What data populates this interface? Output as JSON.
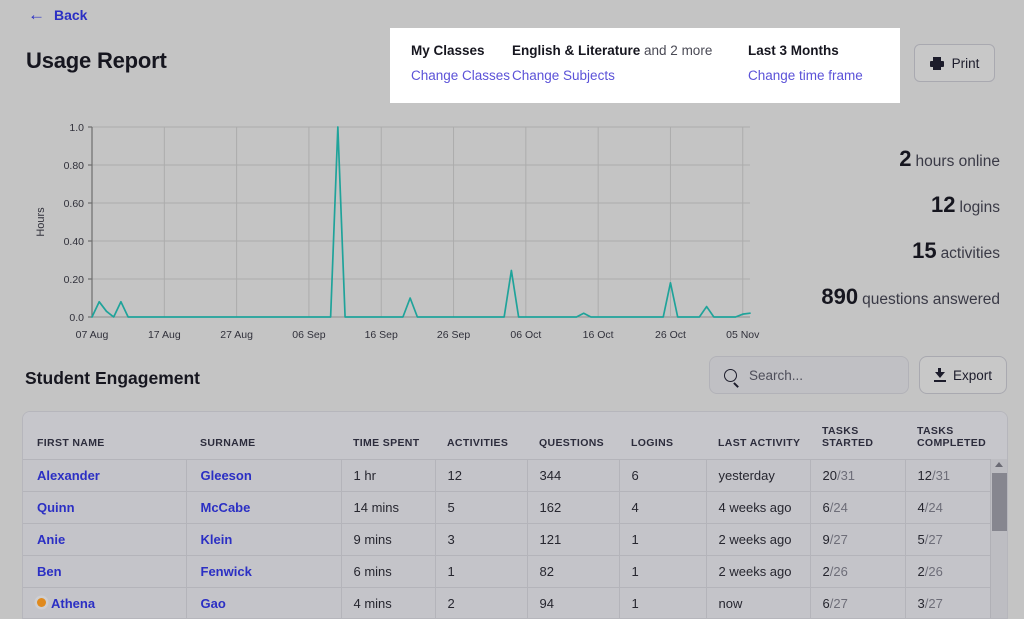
{
  "nav": {
    "back_label": "Back",
    "back_icon": "arrow-left-icon"
  },
  "header": {
    "title": "Usage Report"
  },
  "filters": {
    "classes": {
      "title": "My Classes",
      "title_muted": "",
      "link": "Change Classes"
    },
    "subjects": {
      "title": "English & Literature",
      "title_muted": " and 2 more",
      "link": "Change Subjects"
    },
    "timeframe": {
      "title": "Last 3 Months",
      "title_muted": "",
      "link": "Change time frame"
    }
  },
  "print_button": {
    "label": "Print",
    "icon": "printer-icon"
  },
  "stats": [
    {
      "value": "2",
      "label": "hours online"
    },
    {
      "value": "12",
      "label": "logins"
    },
    {
      "value": "15",
      "label": "activities"
    },
    {
      "value": "890",
      "label": "questions answered"
    }
  ],
  "engagement": {
    "title": "Student Engagement"
  },
  "search": {
    "placeholder": "Search...",
    "value": "",
    "icon": "search-icon"
  },
  "export_button": {
    "label": "Export",
    "icon": "download-icon"
  },
  "table": {
    "columns": [
      {
        "line1": "FIRST NAME",
        "line2": ""
      },
      {
        "line1": "SURNAME",
        "line2": ""
      },
      {
        "line1": "TIME SPENT",
        "line2": ""
      },
      {
        "line1": "ACTIVITIES",
        "line2": ""
      },
      {
        "line1": "QUESTIONS",
        "line2": ""
      },
      {
        "line1": "LOGINS",
        "line2": ""
      },
      {
        "line1": "LAST ACTIVITY",
        "line2": ""
      },
      {
        "line1": "TASKS",
        "line2": "STARTED"
      },
      {
        "line1": "TASKS",
        "line2": "COMPLETED"
      }
    ],
    "rows": [
      {
        "online": false,
        "first": "Alexander",
        "surname": "Gleeson",
        "time": "1 hr",
        "activities": "12",
        "questions": "344",
        "logins": "6",
        "last_activity": "yesterday",
        "started_num": "20",
        "started_den": "/31",
        "completed_num": "12",
        "completed_den": "/31"
      },
      {
        "online": false,
        "first": "Quinn",
        "surname": "McCabe",
        "time": "14 mins",
        "activities": "5",
        "questions": "162",
        "logins": "4",
        "last_activity": "4 weeks ago",
        "started_num": "6",
        "started_den": "/24",
        "completed_num": "4",
        "completed_den": "/24"
      },
      {
        "online": false,
        "first": "Anie",
        "surname": "Klein",
        "time": "9 mins",
        "activities": "3",
        "questions": "121",
        "logins": "1",
        "last_activity": "2 weeks ago",
        "started_num": "9",
        "started_den": "/27",
        "completed_num": "5",
        "completed_den": "/27"
      },
      {
        "online": false,
        "first": "Ben",
        "surname": "Fenwick",
        "time": "6 mins",
        "activities": "1",
        "questions": "82",
        "logins": "1",
        "last_activity": "2 weeks ago",
        "started_num": "2",
        "started_den": "/26",
        "completed_num": "2",
        "completed_den": "/26"
      },
      {
        "online": true,
        "first": "Athena",
        "surname": "Gao",
        "time": "4 mins",
        "activities": "2",
        "questions": "94",
        "logins": "1",
        "last_activity": "now",
        "started_num": "6",
        "started_den": "/27",
        "completed_num": "3",
        "completed_den": "/27"
      }
    ]
  },
  "colors": {
    "page_bg": "#c4c4c4",
    "panel_white": "#ffffff",
    "link_blue": "#2b2fc4",
    "link_purple": "#5b52d8",
    "chart_line": "#1fa39a",
    "grid": "#acacac",
    "online_dot": "#e08a1e"
  },
  "chart_data": {
    "type": "line",
    "title": "",
    "xlabel": "",
    "ylabel": "Hours",
    "ylim": [
      0,
      1.0
    ],
    "yticks": [
      "0.0",
      "0.20",
      "0.40",
      "0.60",
      "0.80",
      "1.0"
    ],
    "ytick_values": [
      0,
      0.2,
      0.4,
      0.6,
      0.8,
      1.0
    ],
    "xticks": [
      "07 Aug",
      "17 Aug",
      "27 Aug",
      "06 Sep",
      "16 Sep",
      "26 Sep",
      "06 Oct",
      "16 Oct",
      "26 Oct",
      "05 Nov"
    ],
    "xtick_values": [
      0,
      10,
      20,
      30,
      40,
      50,
      60,
      70,
      80,
      90
    ],
    "grid": true,
    "legend": "none",
    "series": [
      {
        "name": "Hours",
        "x": [
          0,
          1,
          2,
          3,
          4,
          5,
          6,
          7,
          8,
          9,
          10,
          11,
          12,
          13,
          14,
          15,
          16,
          17,
          18,
          19,
          20,
          21,
          22,
          23,
          24,
          25,
          26,
          27,
          28,
          29,
          30,
          31,
          32,
          33,
          34,
          35,
          36,
          37,
          38,
          39,
          40,
          41,
          42,
          43,
          44,
          45,
          46,
          47,
          48,
          49,
          50,
          51,
          52,
          53,
          54,
          55,
          56,
          57,
          58,
          59,
          60,
          61,
          62,
          63,
          64,
          65,
          66,
          67,
          68,
          69,
          70,
          71,
          72,
          73,
          74,
          75,
          76,
          77,
          78,
          79,
          80,
          81,
          82,
          83,
          84,
          85,
          86,
          87,
          88,
          89,
          90,
          91
        ],
        "values": [
          0.0,
          0.08,
          0.03,
          0.0,
          0.08,
          0.0,
          0.0,
          0.0,
          0.0,
          0.0,
          0.0,
          0.0,
          0.0,
          0.0,
          0.0,
          0.0,
          0.0,
          0.0,
          0.0,
          0.0,
          0.0,
          0.0,
          0.0,
          0.0,
          0.0,
          0.0,
          0.0,
          0.0,
          0.0,
          0.0,
          0.0,
          0.0,
          0.0,
          0.0,
          1.0,
          0.0,
          0.0,
          0.0,
          0.0,
          0.0,
          0.0,
          0.0,
          0.0,
          0.0,
          0.1,
          0.0,
          0.0,
          0.0,
          0.0,
          0.0,
          0.0,
          0.0,
          0.0,
          0.0,
          0.0,
          0.0,
          0.0,
          0.0,
          0.245,
          0.0,
          0.0,
          0.0,
          0.0,
          0.0,
          0.0,
          0.0,
          0.0,
          0.0,
          0.02,
          0.0,
          0.0,
          0.0,
          0.0,
          0.0,
          0.0,
          0.0,
          0.0,
          0.0,
          0.0,
          0.0,
          0.18,
          0.0,
          0.0,
          0.0,
          0.0,
          0.055,
          0.0,
          0.0,
          0.0,
          0.0,
          0.015,
          0.02
        ]
      }
    ]
  }
}
